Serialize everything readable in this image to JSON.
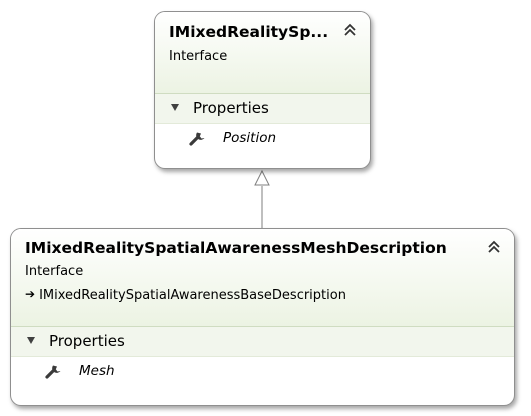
{
  "base_class": {
    "title": "IMixedRealitySp...",
    "stereotype": "Interface",
    "section_label": "Properties",
    "members": [
      {
        "name": "Position",
        "icon": "wrench-icon"
      }
    ]
  },
  "derived_class": {
    "title": "IMixedRealitySpatialAwarenessMeshDescription",
    "stereotype": "Interface",
    "inherits": "IMixedRealitySpatialAwarenessBaseDescription",
    "section_label": "Properties",
    "members": [
      {
        "name": "Mesh",
        "icon": "wrench-icon"
      }
    ]
  },
  "colors": {
    "header_gradient_end": "#ecf3e3",
    "border": "#8f8f8f",
    "section_bg": "#f2f6ed"
  }
}
